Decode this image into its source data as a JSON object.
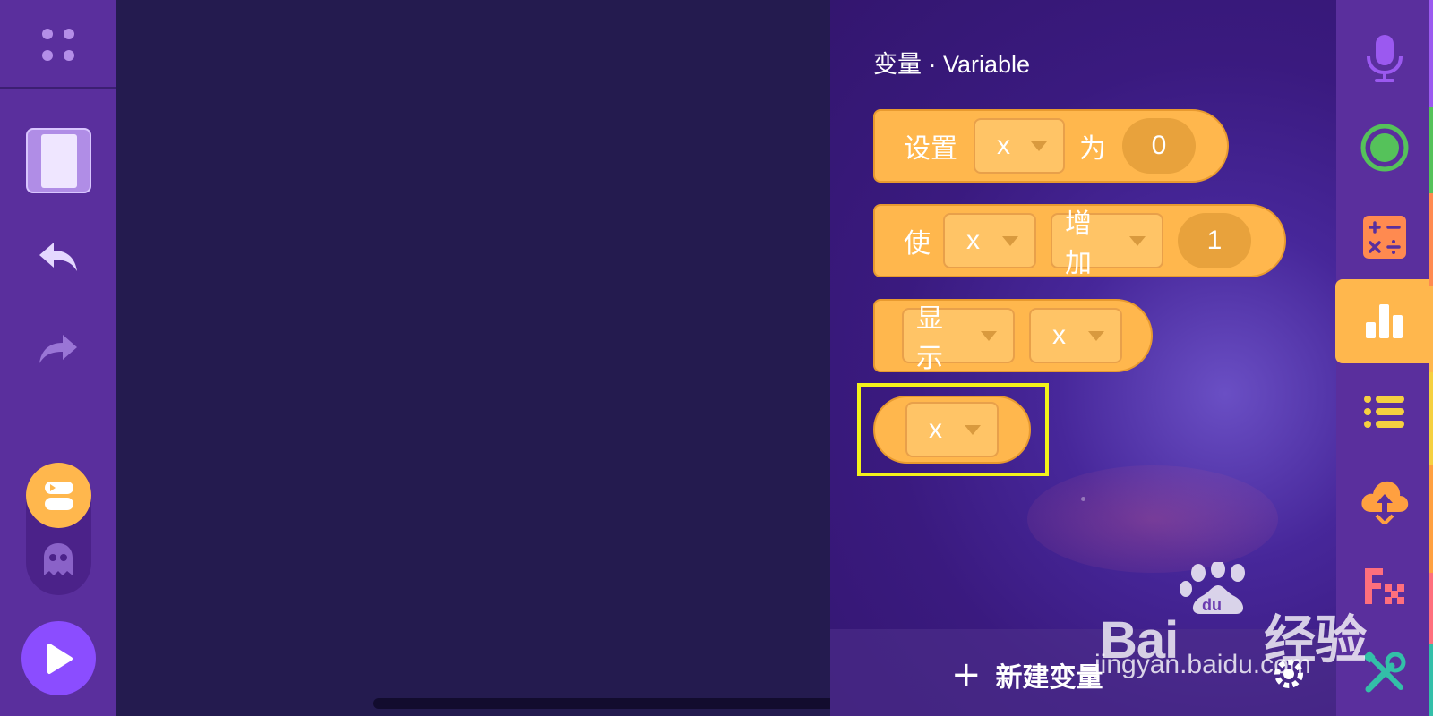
{
  "palette": {
    "title": "变量 · Variable",
    "blocks": {
      "set": {
        "word1": "设置",
        "var": "x",
        "word2": "为",
        "value": "0"
      },
      "change": {
        "word1": "使",
        "var": "x",
        "op": "增加",
        "value": "1"
      },
      "show": {
        "mode": "显示",
        "var": "x"
      },
      "reporter": {
        "var": "x"
      }
    },
    "footer": {
      "new_variable": "新建变量"
    }
  },
  "right_categories": [
    {
      "name": "microphone-icon",
      "color": "#9b59f0"
    },
    {
      "name": "record-icon",
      "color": "#55c25a"
    },
    {
      "name": "operators-icon",
      "color": "#ff8a50"
    },
    {
      "name": "variables-icon",
      "color": "#ffb74d",
      "active": true
    },
    {
      "name": "list-icon",
      "color": "#f5d040"
    },
    {
      "name": "cloud-upload-icon",
      "color": "#ffa040"
    },
    {
      "name": "function-icon",
      "color": "#ff6f7d"
    },
    {
      "name": "tools-icon",
      "color": "#33bfa8"
    }
  ],
  "watermark": {
    "url": "jingyan.baidu.com"
  },
  "colors": {
    "block": "#ffb74d",
    "highlight": "#f4f21a",
    "toolbar": "#5a2f9d",
    "canvas": "#241b4f"
  }
}
